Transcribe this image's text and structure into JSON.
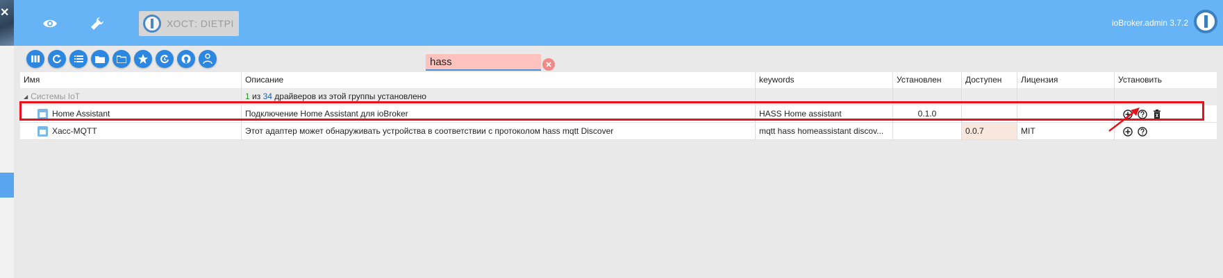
{
  "header": {
    "host_label": "ХОСТ: DIETPI",
    "version": "ioBroker.admin 3.7.2"
  },
  "toolbar": {
    "buttons": [
      "view-columns-icon",
      "refresh-icon",
      "list-icon",
      "folder-icon",
      "folder-open-icon",
      "star-icon",
      "update-icon",
      "github-icon",
      "user-icon"
    ]
  },
  "search": {
    "value": "hass"
  },
  "table": {
    "headers": {
      "name": "Имя",
      "desc": "Описание",
      "keywords": "keywords",
      "installed": "Установлен",
      "available": "Доступен",
      "license": "Лицензия",
      "install": "Установить"
    },
    "group": {
      "name": "Системы IoT",
      "installed_count": "1",
      "text_mid": "из",
      "total_count": "34",
      "text_end": "драйверов из этой группы установлено"
    },
    "rows": [
      {
        "name": "Home Assistant",
        "desc": "Подключение Home Assistant для ioBroker",
        "keywords": "HASS Home assistant",
        "installed": "0.1.0",
        "available": "",
        "license": ""
      },
      {
        "name": "Хасс-MQTT",
        "desc": "Этот адаптер может обнаруживать устройства в соответствии с протоколом hass mqtt Discover",
        "keywords": "mqtt hass homeassistant discov...",
        "installed": "",
        "available": "0.0.7",
        "license": "MIT"
      }
    ]
  },
  "colors": {
    "header": "#66b3f5",
    "toolbar_button": "#2b87e0",
    "search_bg": "#ffc2bd",
    "highlight": "#e4131b"
  }
}
